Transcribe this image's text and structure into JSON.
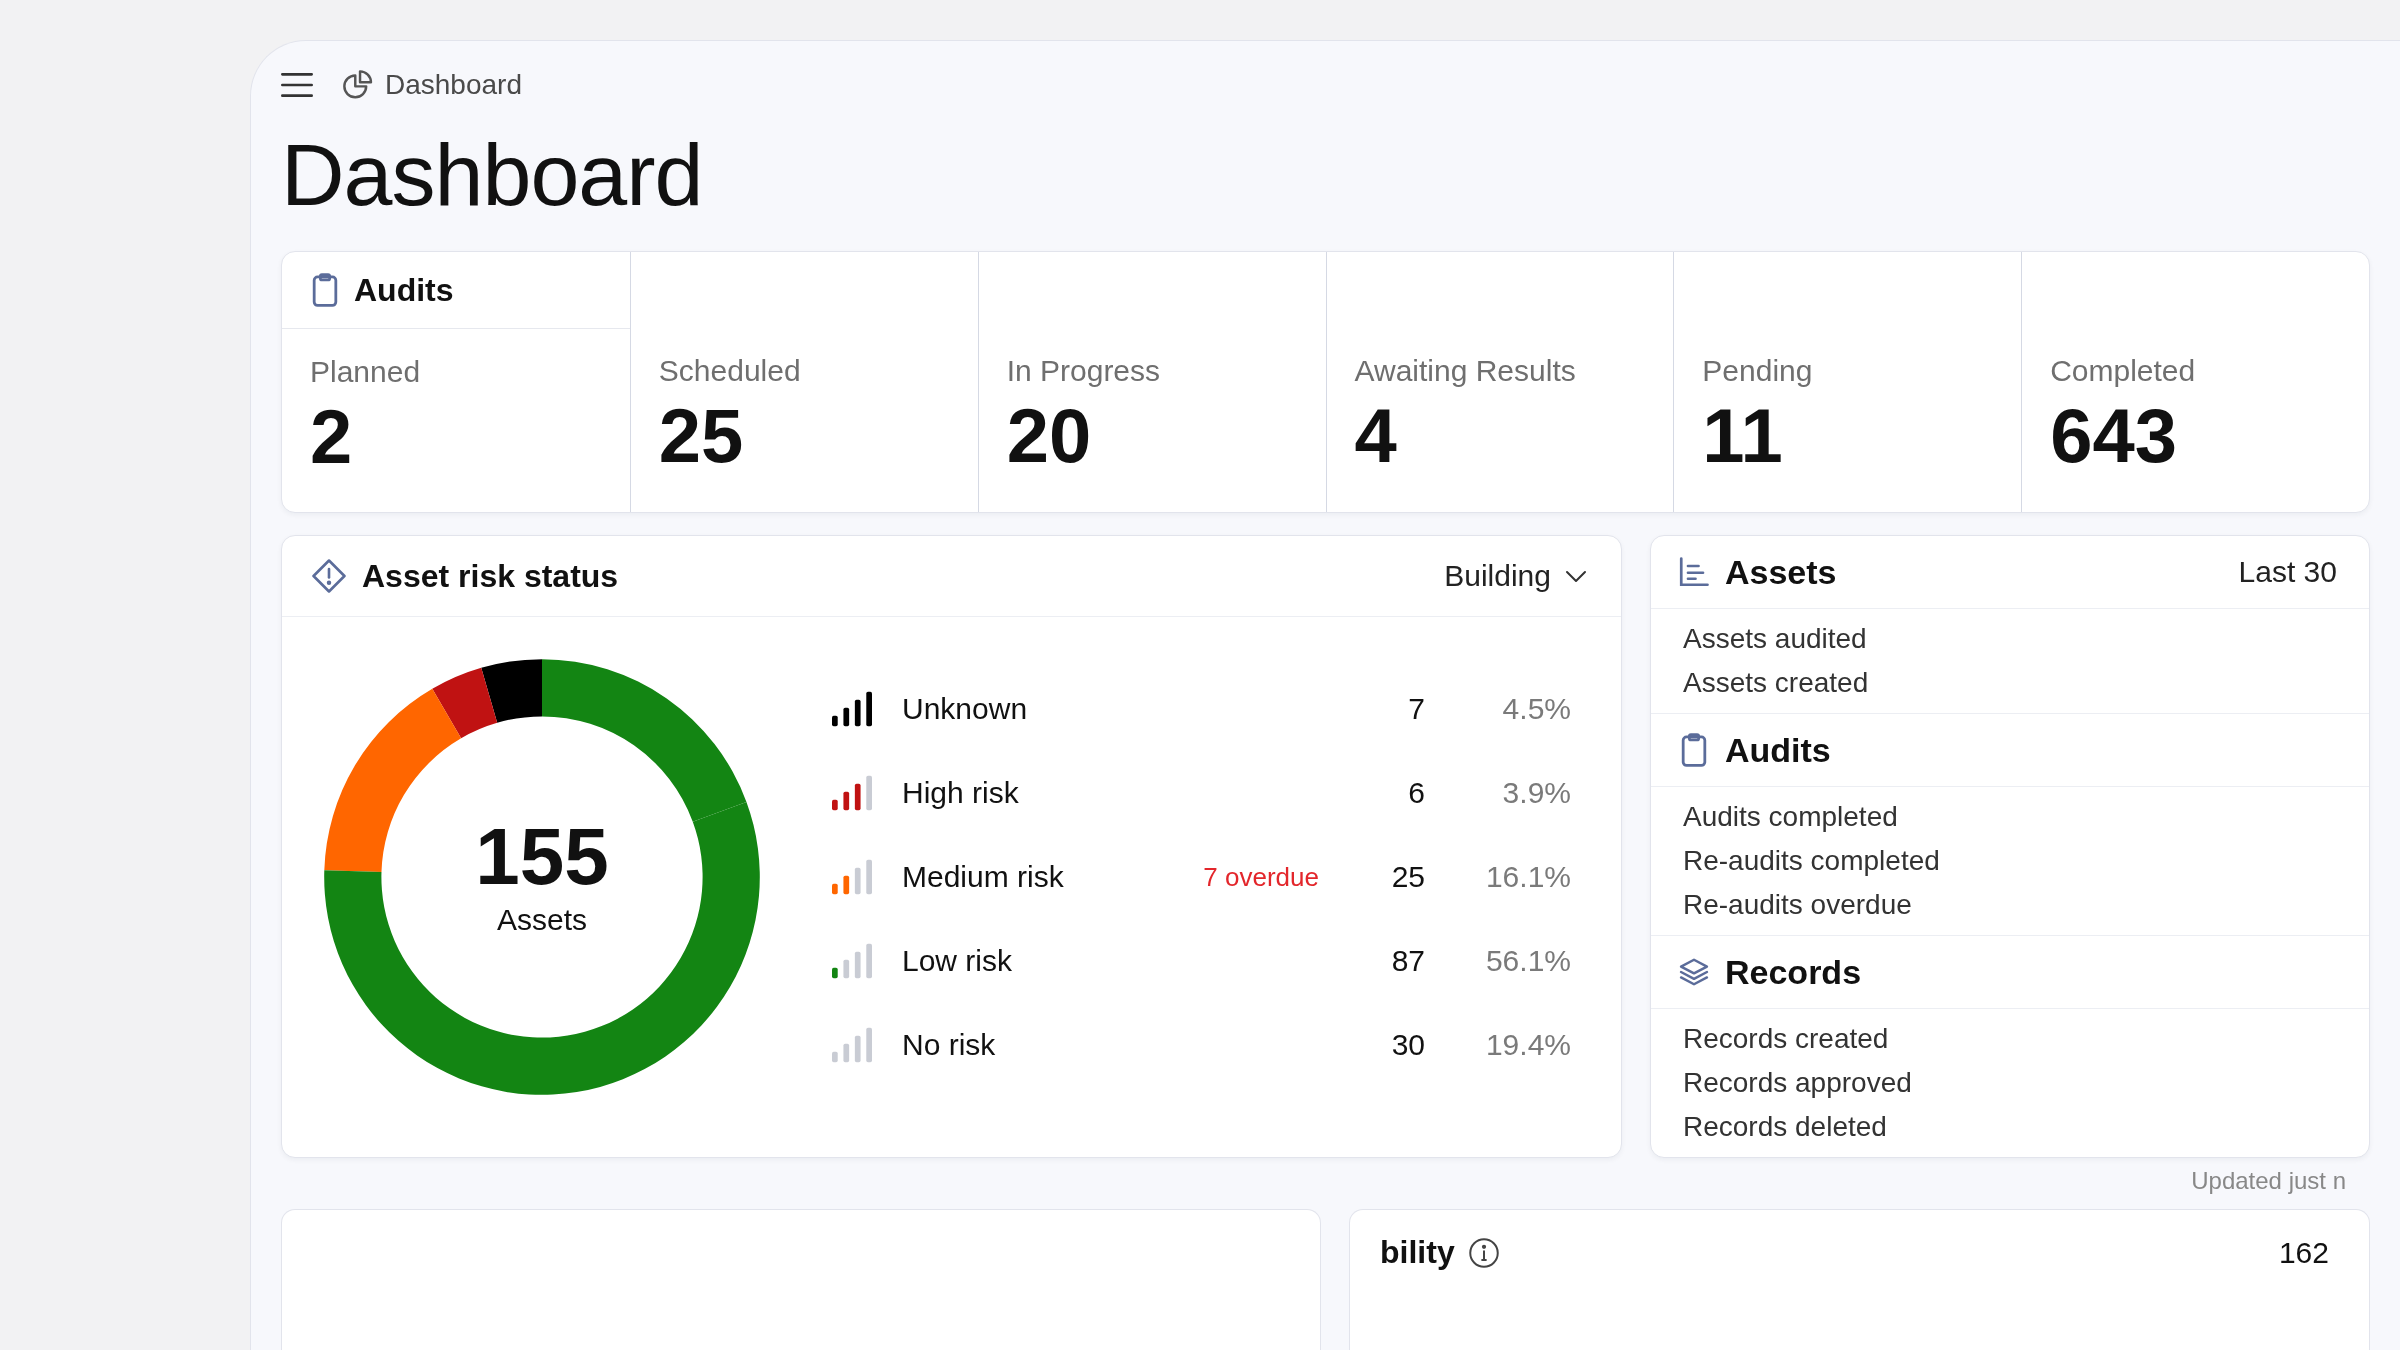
{
  "topbar": {
    "breadcrumb": "Dashboard"
  },
  "title": "Dashboard",
  "audits": {
    "title": "Audits",
    "stats": [
      {
        "label": "Planned",
        "value": "2"
      },
      {
        "label": "Scheduled",
        "value": "25"
      },
      {
        "label": "In Progress",
        "value": "20"
      },
      {
        "label": "Awaiting Results",
        "value": "4"
      },
      {
        "label": "Pending",
        "value": "11"
      },
      {
        "label": "Completed",
        "value": "643"
      }
    ]
  },
  "risk": {
    "title": "Asset risk status",
    "filter": "Building",
    "total": "155",
    "total_label": "Assets",
    "chart_data": {
      "type": "donut",
      "categories": [
        "Unknown",
        "High risk",
        "Medium risk",
        "Low risk",
        "No risk"
      ],
      "values": [
        4.5,
        3.9,
        16.1,
        56.1,
        19.4
      ]
    },
    "legend": [
      {
        "kind": "unknown",
        "color": "#000000",
        "count": "7",
        "percent": "4.5%"
      },
      {
        "kind": "high",
        "color": "#c01212",
        "count": "6",
        "percent": "3.9%"
      },
      {
        "kind": "medium",
        "color": "#ff6600",
        "count": "25",
        "percent": "16.1%",
        "note": "7 overdue"
      },
      {
        "kind": "low",
        "color": "#138513",
        "count": "87",
        "percent": "56.1%"
      },
      {
        "kind": "none",
        "count": "30",
        "percent": "19.4%"
      }
    ]
  },
  "activity": {
    "period": "Last 30",
    "sections": [
      {
        "kind": "assets",
        "title": "Assets",
        "items": [
          "Assets audited",
          "Assets created"
        ]
      },
      {
        "kind": "audits",
        "title": "Audits",
        "items": [
          "Audits completed",
          "Re-audits completed",
          "Re-audits overdue"
        ]
      },
      {
        "kind": "records",
        "title": "Records",
        "items": [
          "Records created",
          "Records approved",
          "Records deleted"
        ]
      }
    ],
    "updated": "Updated just n"
  },
  "bottom_panel": {
    "title": "bility",
    "value": "162"
  }
}
